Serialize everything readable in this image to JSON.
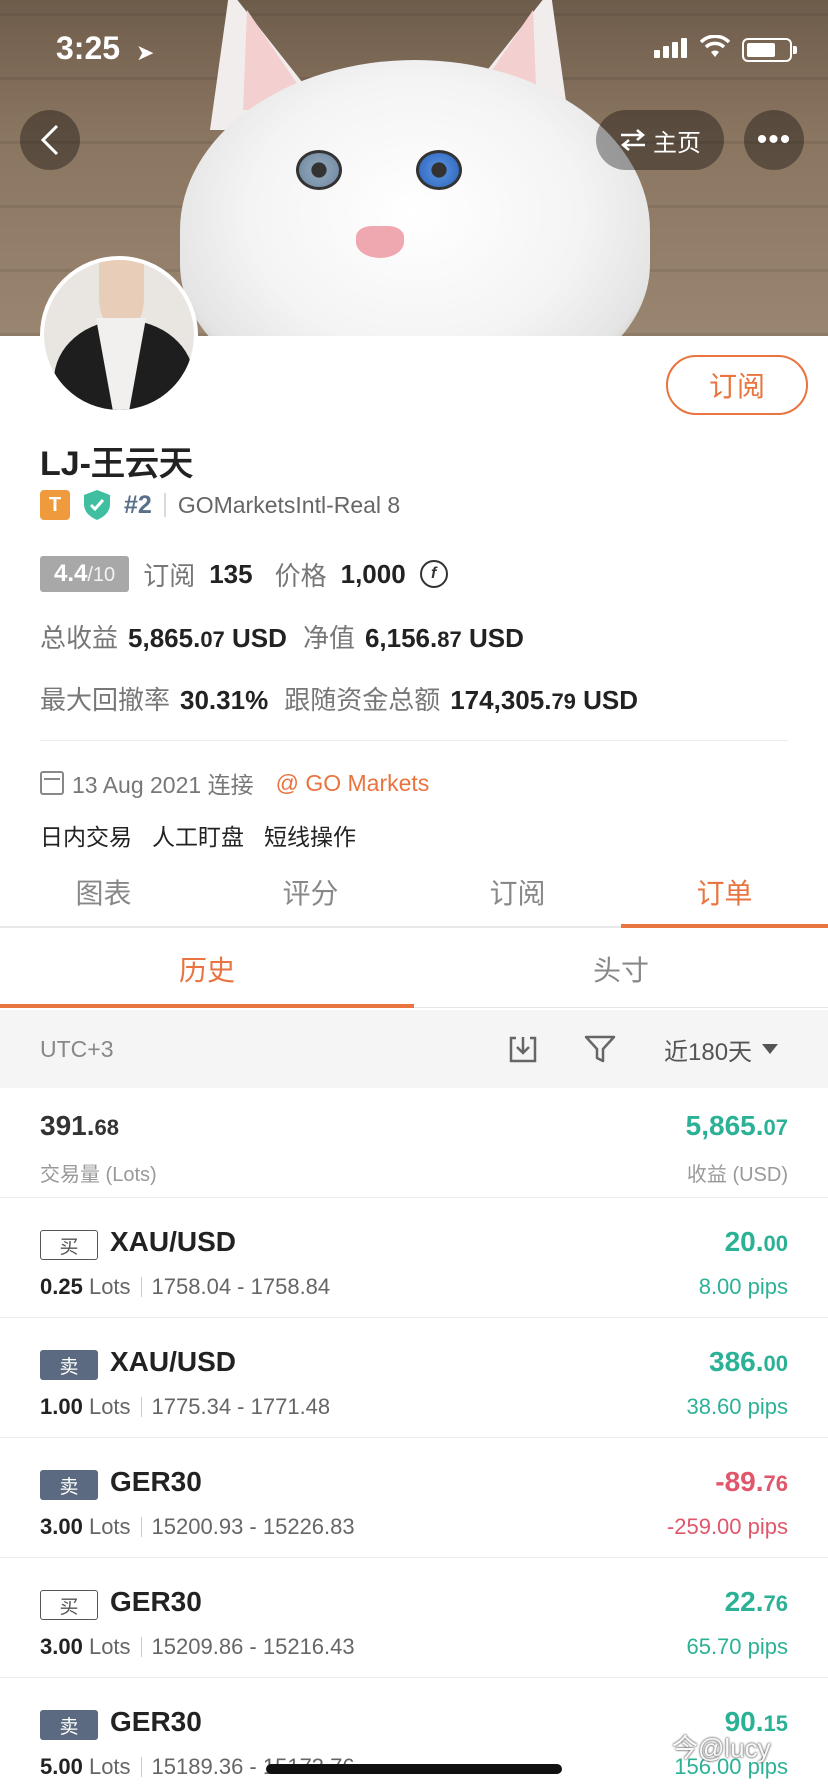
{
  "status_bar": {
    "time": "3:25"
  },
  "nav": {
    "home_label": "主页"
  },
  "profile": {
    "name": "LJ-王云天",
    "tier_badge": "T",
    "rank": "#2",
    "account": "GOMarketsIntl-Real 8",
    "subscribe_label": "订阅",
    "score": "4.4",
    "score_max": "/10",
    "subs_label": "订阅",
    "subs_value": "135",
    "price_label": "价格",
    "price_value": "1,000",
    "total_profit_label": "总收益",
    "total_profit_int": "5,865.",
    "total_profit_dec": "07",
    "total_profit_unit": "USD",
    "equity_label": "净值",
    "equity_int": "6,156.",
    "equity_dec": "87",
    "equity_unit": "USD",
    "drawdown_label": "最大回撤率",
    "drawdown_value": "30.31%",
    "follow_funds_label": "跟随资金总额",
    "follow_funds_int": "174,305.",
    "follow_funds_dec": "79",
    "follow_funds_unit": "USD",
    "connected": "13 Aug 2021 连接",
    "broker": "@ GO Markets",
    "tags": [
      "日内交易",
      "人工盯盘",
      "短线操作"
    ]
  },
  "tabs": [
    {
      "label": "图表",
      "active": false
    },
    {
      "label": "评分",
      "active": false
    },
    {
      "label": "订阅",
      "active": false
    },
    {
      "label": "订单",
      "active": true
    }
  ],
  "subtabs": [
    {
      "label": "历史",
      "active": true
    },
    {
      "label": "头寸",
      "active": false
    }
  ],
  "toolbar": {
    "timezone": "UTC+3",
    "range": "近180天"
  },
  "summary": {
    "lots_int": "391.",
    "lots_dec": "68",
    "lots_label": "交易量 (Lots)",
    "profit_int": "5,865.",
    "profit_dec": "07",
    "profit_label": "收益 (USD)"
  },
  "trades": [
    {
      "side": "买",
      "side_type": "buy",
      "symbol": "XAU/USD",
      "lots": "0.25",
      "lots_unit": "Lots",
      "prices": "1758.04 - 1758.84",
      "pnl_int": "20.",
      "pnl_dec": "00",
      "pips": "8.00 pips",
      "sign": "pos"
    },
    {
      "side": "卖",
      "side_type": "sell",
      "symbol": "XAU/USD",
      "lots": "1.00",
      "lots_unit": "Lots",
      "prices": "1775.34 - 1771.48",
      "pnl_int": "386.",
      "pnl_dec": "00",
      "pips": "38.60 pips",
      "sign": "pos"
    },
    {
      "side": "卖",
      "side_type": "sell",
      "symbol": "GER30",
      "lots": "3.00",
      "lots_unit": "Lots",
      "prices": "15200.93 - 15226.83",
      "pnl_int": "-89.",
      "pnl_dec": "76",
      "pips": "-259.00 pips",
      "sign": "neg"
    },
    {
      "side": "买",
      "side_type": "buy",
      "symbol": "GER30",
      "lots": "3.00",
      "lots_unit": "Lots",
      "prices": "15209.86 - 15216.43",
      "pnl_int": "22.",
      "pnl_dec": "76",
      "pips": "65.70 pips",
      "sign": "pos"
    },
    {
      "side": "卖",
      "side_type": "sell",
      "symbol": "GER30",
      "lots": "5.00",
      "lots_unit": "Lots",
      "prices": "15189.36 - 15173.76",
      "pnl_int": "90.",
      "pnl_dec": "15",
      "pips": "156.00 pips",
      "sign": "pos"
    }
  ],
  "watermark": "今@lucy",
  "colors": {
    "accent": "#e9743f",
    "profit": "#2bb196",
    "loss": "#e0566a",
    "sell_badge": "#5b6a80"
  }
}
